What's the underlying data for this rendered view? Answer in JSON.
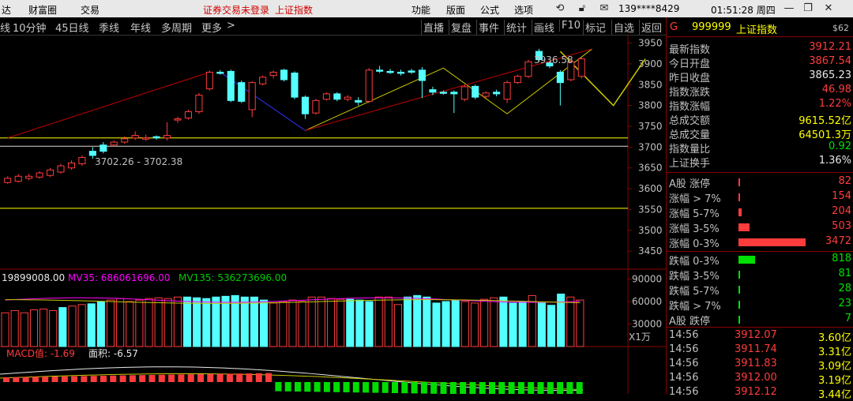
{
  "menubar": {
    "left_items": [
      "达",
      "财富圈",
      "交易"
    ],
    "warning": "证券交易未登录",
    "index_name": "上证指数",
    "right_items": [
      "功能",
      "版面",
      "公式",
      "选项"
    ],
    "phone": "139****8429",
    "clock": "01:51:28 周四"
  },
  "toolbar": {
    "periods": [
      "线",
      "10分钟",
      "45日线",
      "季线",
      "年线",
      "多周期",
      "更多"
    ],
    "buttons": [
      "直播",
      "复盘",
      "事件",
      "统计",
      "画线",
      "F10",
      "标记",
      "自选",
      "返回"
    ]
  },
  "chart_data": [
    {
      "type": "candlestick",
      "title": "",
      "y_ticks": [
        3450,
        3500,
        3550,
        3600,
        3650,
        3700,
        3750,
        3800,
        3850,
        3900,
        3950
      ],
      "ylim": [
        3420,
        3970
      ],
      "candles": [
        {
          "o": 3615,
          "c": 3625,
          "h": 3630,
          "l": 3612
        },
        {
          "o": 3618,
          "c": 3630,
          "h": 3635,
          "l": 3615
        },
        {
          "o": 3625,
          "c": 3630,
          "h": 3636,
          "l": 3620
        },
        {
          "o": 3628,
          "c": 3638,
          "h": 3642,
          "l": 3624
        },
        {
          "o": 3632,
          "c": 3645,
          "h": 3650,
          "l": 3628
        },
        {
          "o": 3640,
          "c": 3655,
          "h": 3660,
          "l": 3636
        },
        {
          "o": 3650,
          "c": 3662,
          "h": 3668,
          "l": 3646
        },
        {
          "o": 3660,
          "c": 3675,
          "h": 3680,
          "l": 3655
        },
        {
          "o": 3690,
          "c": 3680,
          "h": 3700,
          "l": 3672
        },
        {
          "o": 3705,
          "c": 3690,
          "h": 3712,
          "l": 3685
        },
        {
          "o": 3705,
          "c": 3712,
          "h": 3716,
          "l": 3702
        },
        {
          "o": 3712,
          "c": 3720,
          "h": 3726,
          "l": 3708
        },
        {
          "o": 3722,
          "c": 3728,
          "h": 3738,
          "l": 3717
        },
        {
          "o": 3720,
          "c": 3722,
          "h": 3730,
          "l": 3715
        },
        {
          "o": 3725,
          "c": 3722,
          "h": 3728,
          "l": 3718
        },
        {
          "o": 3722,
          "c": 3728,
          "h": 3760,
          "l": 3716
        },
        {
          "o": 3765,
          "c": 3768,
          "h": 3773,
          "l": 3758
        },
        {
          "o": 3770,
          "c": 3785,
          "h": 3790,
          "l": 3766
        },
        {
          "o": 3785,
          "c": 3825,
          "h": 3830,
          "l": 3780
        },
        {
          "o": 3840,
          "c": 3880,
          "h": 3884,
          "l": 3836
        },
        {
          "o": 3880,
          "c": 3878,
          "h": 3885,
          "l": 3874
        },
        {
          "o": 3882,
          "c": 3812,
          "h": 3886,
          "l": 3808
        },
        {
          "o": 3855,
          "c": 3810,
          "h": 3860,
          "l": 3806
        },
        {
          "o": 3790,
          "c": 3855,
          "h": 3858,
          "l": 3772
        },
        {
          "o": 3852,
          "c": 3868,
          "h": 3872,
          "l": 3848
        },
        {
          "o": 3872,
          "c": 3880,
          "h": 3884,
          "l": 3865
        },
        {
          "o": 3885,
          "c": 3862,
          "h": 3888,
          "l": 3858
        },
        {
          "o": 3878,
          "c": 3820,
          "h": 3882,
          "l": 3815
        },
        {
          "o": 3820,
          "c": 3780,
          "h": 3824,
          "l": 3768
        },
        {
          "o": 3782,
          "c": 3812,
          "h": 3816,
          "l": 3778
        },
        {
          "o": 3815,
          "c": 3828,
          "h": 3832,
          "l": 3812
        },
        {
          "o": 3828,
          "c": 3815,
          "h": 3832,
          "l": 3810
        },
        {
          "o": 3815,
          "c": 3820,
          "h": 3825,
          "l": 3810
        },
        {
          "o": 3812,
          "c": 3808,
          "h": 3820,
          "l": 3800
        },
        {
          "o": 3810,
          "c": 3885,
          "h": 3890,
          "l": 3806
        },
        {
          "o": 3885,
          "c": 3883,
          "h": 3895,
          "l": 3878
        },
        {
          "o": 3882,
          "c": 3880,
          "h": 3888,
          "l": 3876
        },
        {
          "o": 3880,
          "c": 3878,
          "h": 3886,
          "l": 3872
        },
        {
          "o": 3883,
          "c": 3880,
          "h": 3888,
          "l": 3876
        },
        {
          "o": 3885,
          "c": 3860,
          "h": 3892,
          "l": 3818
        },
        {
          "o": 3838,
          "c": 3832,
          "h": 3845,
          "l": 3825
        },
        {
          "o": 3832,
          "c": 3830,
          "h": 3836,
          "l": 3826
        },
        {
          "o": 3832,
          "c": 3828,
          "h": 3836,
          "l": 3782
        },
        {
          "o": 3815,
          "c": 3845,
          "h": 3850,
          "l": 3810
        },
        {
          "o": 3846,
          "c": 3820,
          "h": 3850,
          "l": 3815
        },
        {
          "o": 3822,
          "c": 3830,
          "h": 3834,
          "l": 3818
        },
        {
          "o": 3832,
          "c": 3828,
          "h": 3838,
          "l": 3822
        },
        {
          "o": 3815,
          "c": 3855,
          "h": 3860,
          "l": 3806
        },
        {
          "o": 3855,
          "c": 3870,
          "h": 3874,
          "l": 3852
        },
        {
          "o": 3870,
          "c": 3905,
          "h": 3910,
          "l": 3866
        },
        {
          "o": 3930,
          "c": 3910,
          "h": 3936,
          "l": 3905
        },
        {
          "o": 3902,
          "c": 3895,
          "h": 3906,
          "l": 3890
        },
        {
          "o": 3880,
          "c": 3855,
          "h": 3885,
          "l": 3800
        },
        {
          "o": 3862,
          "c": 3905,
          "h": 3908,
          "l": 3858
        },
        {
          "o": 3870,
          "c": 3912,
          "h": 3915,
          "l": 3865
        }
      ],
      "annotations": [
        "3936.58",
        "3702.26 - 3702.38"
      ]
    },
    {
      "type": "bar",
      "title": "19899008.00",
      "series_labels": [
        "MV35: 686061696.00",
        "MV135: 536273696.00"
      ],
      "y_ticks": [
        30000,
        60000,
        90000
      ],
      "ylim": [
        0,
        100000
      ],
      "unit": "X1万",
      "values": [
        45000,
        48000,
        45000,
        49000,
        50000,
        48000,
        52000,
        54000,
        56000,
        57000,
        60000,
        62000,
        64000,
        60000,
        62000,
        64000,
        65000,
        64000,
        66000,
        66000,
        65000,
        64000,
        66000,
        67000,
        68000,
        66000,
        66000,
        62000,
        58000,
        60000,
        62000,
        60000,
        66000,
        66000,
        64000,
        63000,
        63000,
        62000,
        60000,
        66000,
        66000,
        56000,
        66000,
        68000,
        66000,
        58000,
        60000,
        62000,
        60000,
        58000,
        63000,
        65000,
        66000,
        58000,
        60000,
        68000,
        58000,
        55000,
        70000,
        66000,
        62000
      ],
      "down_flags": [
        0,
        0,
        0,
        0,
        0,
        0,
        1,
        0,
        0,
        1,
        1,
        0,
        0,
        0,
        0,
        0,
        0,
        0,
        0,
        1,
        1,
        1,
        1,
        1,
        1,
        1,
        1,
        1,
        0,
        0,
        0,
        0,
        0,
        0,
        0,
        0,
        1,
        1,
        1,
        0,
        0,
        0,
        1,
        1,
        1,
        1,
        1,
        1,
        0,
        0,
        0,
        0,
        1,
        1,
        1,
        0,
        1,
        1,
        1,
        0,
        0
      ]
    },
    {
      "type": "line",
      "title": "MACD值: -1.69",
      "subtitle": "面积: -6.57"
    }
  ],
  "side": {
    "header_code": "G",
    "header_symbol": "999999",
    "header_name": "上证指数",
    "header_right": "$62",
    "stats": [
      {
        "label": "最新指数",
        "value": "3912.21",
        "color": "red"
      },
      {
        "label": "今日开盘",
        "value": "3867.54",
        "color": "red"
      },
      {
        "label": "昨日收盘",
        "value": "3865.23",
        "color": "wht"
      },
      {
        "label": "指数涨跌",
        "value": "46.98",
        "color": "red"
      },
      {
        "label": "指数涨幅",
        "value": "1.22%",
        "color": "red"
      },
      {
        "label": "总成交额",
        "value": "9615.52亿",
        "color": "yel"
      },
      {
        "label": "总成交量",
        "value": "64501.3万",
        "color": "yel"
      },
      {
        "label": "指数量比",
        "value": "0.92",
        "color": "grn"
      },
      {
        "label": "上证换手",
        "value": "1.36%",
        "color": "wht"
      }
    ],
    "breadth_up": [
      {
        "label": "A股 涨停",
        "value": "82",
        "frac": 0.02
      },
      {
        "label": "涨幅 > 7%",
        "value": "154",
        "frac": 0.02
      },
      {
        "label": "涨幅 5-7%",
        "value": "204",
        "frac": 0.05
      },
      {
        "label": "涨幅 3-5%",
        "value": "503",
        "frac": 0.16
      },
      {
        "label": "涨幅 0-3%",
        "value": "3472",
        "frac": 1.0
      }
    ],
    "breadth_down": [
      {
        "label": "跌幅 0-3%",
        "value": "818",
        "frac": 0.25
      },
      {
        "label": "跌幅 3-5%",
        "value": "81",
        "frac": 0.02
      },
      {
        "label": "跌幅 5-7%",
        "value": "28",
        "frac": 0.01
      },
      {
        "label": "跌幅 > 7%",
        "value": "23",
        "frac": 0.01
      },
      {
        "label": "A股 跌停",
        "value": "7",
        "frac": 0.005
      }
    ],
    "ticks": [
      {
        "time": "14:56",
        "price": "3912.07",
        "amount": "3.60亿"
      },
      {
        "time": "14:56",
        "price": "3911.74",
        "amount": "3.31亿"
      },
      {
        "time": "14:56",
        "price": "3911.83",
        "amount": "3.09亿"
      },
      {
        "time": "14:56",
        "price": "3912.00",
        "amount": "3.19亿"
      },
      {
        "time": "14:56",
        "price": "3912.12",
        "amount": "3.44亿"
      }
    ]
  },
  "colors": {
    "up": "#ff3c3c",
    "down": "#54ffff",
    "grid": "#8b0000",
    "yellow": "#ffff00"
  }
}
